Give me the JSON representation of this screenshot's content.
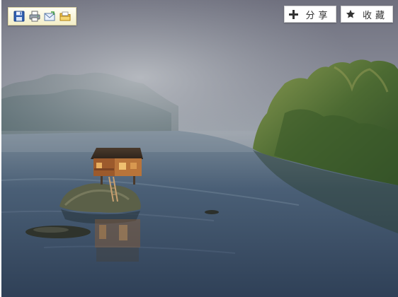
{
  "toolbar": {
    "icons": [
      "save-icon",
      "print-icon",
      "email-icon",
      "open-folder-icon"
    ]
  },
  "actions": {
    "share_label": "分享",
    "share_icon": "plus-icon",
    "favorite_label": "收藏",
    "favorite_icon": "star-icon"
  },
  "colors": {
    "toolbar_bg": "#f7f3d6",
    "button_bg": "#ffffff",
    "button_text": "#333333"
  }
}
